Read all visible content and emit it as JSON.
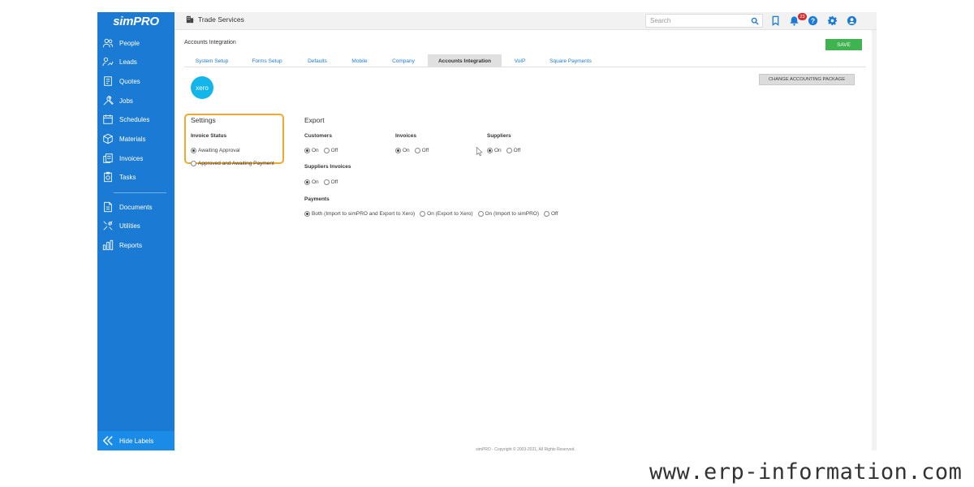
{
  "app": {
    "logo": "simPRO",
    "company": "Trade Services"
  },
  "sidebar": {
    "items": [
      {
        "label": "People",
        "icon": "people-icon"
      },
      {
        "label": "Leads",
        "icon": "leads-icon"
      },
      {
        "label": "Quotes",
        "icon": "quotes-icon"
      },
      {
        "label": "Jobs",
        "icon": "jobs-icon"
      },
      {
        "label": "Schedules",
        "icon": "calendar-icon"
      },
      {
        "label": "Materials",
        "icon": "box-icon"
      },
      {
        "label": "Invoices",
        "icon": "invoices-icon"
      },
      {
        "label": "Tasks",
        "icon": "tasks-icon"
      },
      {
        "label": "Documents",
        "icon": "document-icon"
      },
      {
        "label": "Utilities",
        "icon": "tools-icon"
      },
      {
        "label": "Reports",
        "icon": "reports-icon"
      }
    ],
    "hide_labels": "Hide Labels"
  },
  "topbar": {
    "search_placeholder": "Search",
    "notification_count": "23"
  },
  "page": {
    "title": "Accounts Integration",
    "save_label": "SAVE",
    "tabs": [
      {
        "label": "System Setup",
        "active": false
      },
      {
        "label": "Forms Setup",
        "active": false
      },
      {
        "label": "Defaults",
        "active": false
      },
      {
        "label": "Mobile",
        "active": false
      },
      {
        "label": "Company",
        "active": false
      },
      {
        "label": "Accounts Integration",
        "active": true
      },
      {
        "label": "VoIP",
        "active": false
      },
      {
        "label": "Square Payments",
        "active": false
      }
    ],
    "change_package_label": "CHANGE ACCOUNTING PACKAGE",
    "xero_logo_text": "xero"
  },
  "settings": {
    "heading": "Settings",
    "invoice_status": {
      "label": "Invoice Status",
      "options": [
        "Awaiting Approval",
        "Approved and Awaiting Payment"
      ],
      "selected": "Awaiting Approval"
    }
  },
  "export": {
    "heading": "Export",
    "customers": {
      "label": "Customers",
      "on": "On",
      "off": "Off",
      "selected": "On"
    },
    "invoices": {
      "label": "Invoices",
      "on": "On",
      "off": "Off",
      "selected": "On"
    },
    "suppliers": {
      "label": "Suppliers",
      "on": "On",
      "off": "Off",
      "selected": "On"
    },
    "suppliers_invoices": {
      "label": "Suppliers Invoices",
      "on": "On",
      "off": "Off",
      "selected": "On"
    },
    "payments": {
      "label": "Payments",
      "options": [
        "Both (Import to simPRO and Export to Xero)",
        "On (Export to Xero)",
        "On (Import to simPRO)",
        "Off"
      ],
      "selected": "Both (Import to simPRO and Export to Xero)"
    }
  },
  "footer": {
    "copyright": "simPRO - Copyright © 2003-2021, All Rights Reserved."
  },
  "watermark": "www.erp-information.com",
  "colors": {
    "sidebar": "#1b7bd4",
    "save_button": "#3fb34f",
    "highlight": "#f0a830",
    "xero": "#13b5ea",
    "badge": "#d32f2f"
  }
}
